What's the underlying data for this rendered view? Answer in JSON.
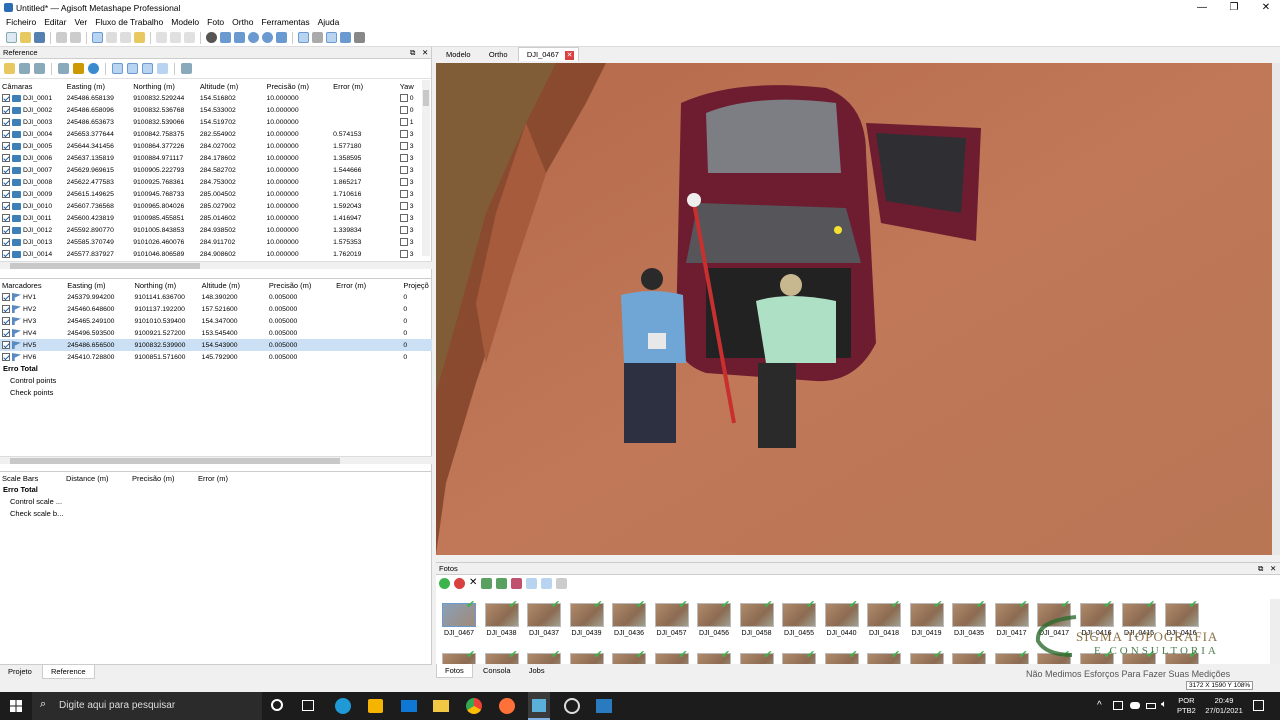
{
  "window": {
    "title": "Untitled* — Agisoft Metashape Professional"
  },
  "menu": [
    "Ficheiro",
    "Editar",
    "Ver",
    "Fluxo de Trabalho",
    "Modelo",
    "Foto",
    "Ortho",
    "Ferramentas",
    "Ajuda"
  ],
  "reference_panel": {
    "title": "Reference"
  },
  "cameras": {
    "headers": [
      "Câmaras",
      "Easting (m)",
      "Northing (m)",
      "Altitude (m)",
      "Precisão (m)",
      "Error (m)",
      "Yaw"
    ],
    "rows": [
      [
        "DJI_0001",
        "245486.658139",
        "9100832.529244",
        "154.516802",
        "10.000000",
        "",
        "0"
      ],
      [
        "DJI_0002",
        "245486.658096",
        "9100832.536768",
        "154.533002",
        "10.000000",
        "",
        "0"
      ],
      [
        "DJI_0003",
        "245486.653673",
        "9100832.539066",
        "154.519702",
        "10.000000",
        "",
        "1"
      ],
      [
        "DJI_0004",
        "245653.377644",
        "9100842.758375",
        "282.554902",
        "10.000000",
        "0.574153",
        "3"
      ],
      [
        "DJI_0005",
        "245644.341456",
        "9100864.377226",
        "284.027002",
        "10.000000",
        "1.577180",
        "3"
      ],
      [
        "DJI_0006",
        "245637.135819",
        "9100884.971117",
        "284.178602",
        "10.000000",
        "1.358595",
        "3"
      ],
      [
        "DJI_0007",
        "245629.969615",
        "9100905.222793",
        "284.582702",
        "10.000000",
        "1.544666",
        "3"
      ],
      [
        "DJI_0008",
        "245622.477583",
        "9100925.768361",
        "284.753002",
        "10.000000",
        "1.865217",
        "3"
      ],
      [
        "DJI_0009",
        "245615.149625",
        "9100945.768733",
        "285.004502",
        "10.000000",
        "1.710616",
        "3"
      ],
      [
        "DJI_0010",
        "245607.736568",
        "9100965.804026",
        "285.027902",
        "10.000000",
        "1.592043",
        "3"
      ],
      [
        "DJI_0011",
        "245600.423819",
        "9100985.455851",
        "285.014602",
        "10.000000",
        "1.416947",
        "3"
      ],
      [
        "DJI_0012",
        "245592.890770",
        "9101005.843853",
        "284.938502",
        "10.000000",
        "1.339834",
        "3"
      ],
      [
        "DJI_0013",
        "245585.370749",
        "9101026.460076",
        "284.911702",
        "10.000000",
        "1.575353",
        "3"
      ],
      [
        "DJI_0014",
        "245577.837927",
        "9101046.806589",
        "284.908602",
        "10.000000",
        "1.762019",
        "3"
      ]
    ]
  },
  "markers": {
    "headers": [
      "Marcadores",
      "Easting (m)",
      "Northing (m)",
      "Altitude (m)",
      "Precisão (m)",
      "Error (m)",
      "Projeçõ"
    ],
    "rows": [
      [
        "HV1",
        "245379.994200",
        "9101141.636700",
        "148.390200",
        "0.005000",
        "",
        "0"
      ],
      [
        "HV2",
        "245460.648600",
        "9101137.192200",
        "157.521600",
        "0.005000",
        "",
        "0"
      ],
      [
        "HV3",
        "245465.249100",
        "9101010.539400",
        "154.347000",
        "0.005000",
        "",
        "0"
      ],
      [
        "HV4",
        "245496.593500",
        "9100921.527200",
        "153.545400",
        "0.005000",
        "",
        "0"
      ],
      [
        "HV5",
        "245486.656500",
        "9100832.539900",
        "154.543900",
        "0.005000",
        "",
        "0"
      ],
      [
        "HV6",
        "245410.728800",
        "9100851.571600",
        "145.792900",
        "0.005000",
        "",
        "0"
      ]
    ],
    "selected_index": 4,
    "total_label": "Erro Total",
    "subtotals": [
      "Control points",
      "Check points"
    ]
  },
  "scalebars": {
    "headers": [
      "Scale Bars",
      "Distance (m)",
      "Precisão (m)",
      "Error (m)"
    ],
    "total_label": "Erro Total",
    "subtotals": [
      "Control scale ...",
      "Check scale b..."
    ]
  },
  "left_tabs": [
    "Projeto",
    "Reference"
  ],
  "view_tabs": [
    "Modelo",
    "Ortho",
    "DJI_0467"
  ],
  "photos_panel": {
    "title": "Fotos",
    "thumbnails": [
      "DJI_0467",
      "DJI_0438",
      "DJI_0437",
      "DJI_0439",
      "DJI_0436",
      "DJI_0457",
      "DJI_0456",
      "DJI_0458",
      "DJI_0455",
      "DJI_0440",
      "DJI_0418",
      "DJI_0419",
      "DJI_0435",
      "DJI_0417",
      "DJI_0417",
      "DJI_0416",
      "DJI_0415",
      "DJI_0416"
    ],
    "tabs": [
      "Fotos",
      "Consola",
      "Jobs"
    ]
  },
  "watermark": {
    "line1": "SIGMA TOPOGRAFIA",
    "line2": "E CONSULTORIA",
    "slogan": "Não Medimos Esforços Para Fazer Suas Medições"
  },
  "status": {
    "dims": "3172 X 1590 Y 108%"
  },
  "taskbar": {
    "search_placeholder": "Digite aqui para pesquisar",
    "lang": "POR",
    "lang2": "PTB2",
    "time": "20:49",
    "date": "27/01/2021"
  }
}
